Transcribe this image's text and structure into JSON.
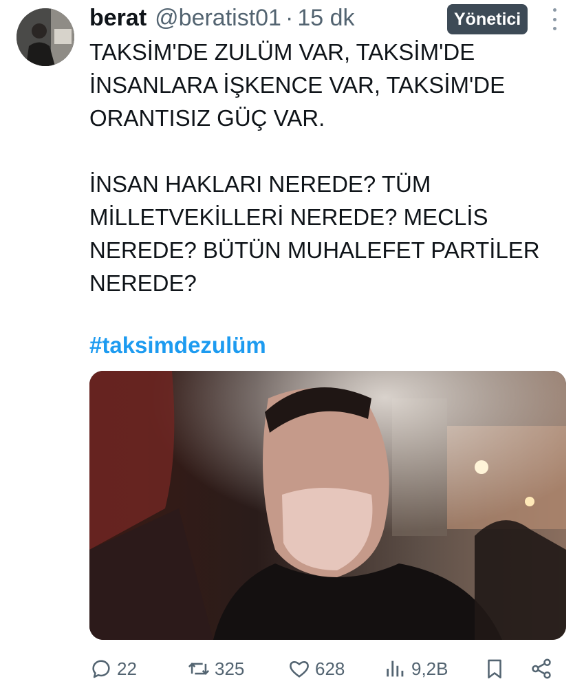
{
  "post": {
    "author_name": "berat",
    "handle": "@beratist01",
    "separator": "·",
    "time": "15 dk",
    "role_badge": "Yönetici",
    "paragraphs": [
      "TAKSİM'DE ZULÜM VAR, TAKSİM'DE İNSANLARA İŞKENCE VAR, TAKSİM'DE ORANTISIZ GÜÇ VAR.",
      "İNSAN HAKLARI NEREDE? TÜM MİLLETVEKİLLERİ NEREDE? MECLİS NEREDE? BÜTÜN MUHALEFET PARTİLER NEREDE?"
    ],
    "hashtag": "#taksimdezulüm"
  },
  "actions": {
    "replies": "22",
    "reposts": "325",
    "likes": "628",
    "views": "9,2B"
  },
  "icons": {
    "reply": "reply-bubble-icon",
    "repost": "repost-arrows-icon",
    "like": "heart-icon",
    "views": "bar-chart-icon",
    "bookmark": "bookmark-icon",
    "share": "share-icon",
    "more": "more-vertical-icon"
  },
  "colors": {
    "text": "#0f1419",
    "secondary": "#536471",
    "hashtag": "#1d9bf0",
    "badge_bg": "#3d4a56",
    "badge_text": "#ffffff"
  }
}
